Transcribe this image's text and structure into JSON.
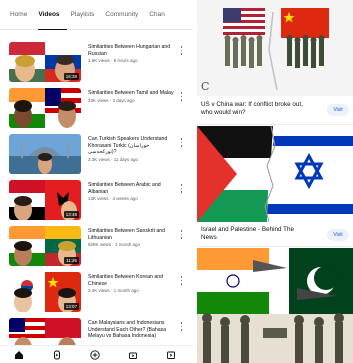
{
  "youtube": {
    "tabs": [
      "Home",
      "Videos",
      "Playlists",
      "Community",
      "Chan"
    ],
    "active_tab": "Videos",
    "videos": [
      {
        "title": "Similarities Between Hungarian and Russian",
        "meta": "1.6K views · 8 hours ago",
        "duration": "16:38"
      },
      {
        "title": "Similarities Between Tamil and Malay",
        "meta": "33K views · 3 days ago",
        "duration": ""
      },
      {
        "title": "Can Turkish Speakers Understand Khorasani Turkic (خوراسان تورکجه‌سی)?",
        "meta": "3.3K views · 11 days ago",
        "duration": ""
      },
      {
        "title": "Similarities Between Arabic and Albanian",
        "meta": "13K views · 3 weeks ago",
        "duration": "13:48"
      },
      {
        "title": "Similarities Between Sanskrit and Lithuanian",
        "meta": "928K views · 1 month ago",
        "duration": "11:26"
      },
      {
        "title": "Similarities Between Korean and Chinese",
        "meta": "3.4K views · 1 month ago",
        "duration": "13:07"
      },
      {
        "title": "Can Malaysians and Indonesians Understand Each Other? (Bahasa Melayu vs Bahasa Indonesia)",
        "meta": "",
        "duration": ""
      }
    ]
  },
  "feed": {
    "visit_label": "Visit",
    "articles": [
      {
        "title": "US v China war: If conflict broke out, who would win?",
        "badge": "C"
      },
      {
        "title": "Israel and Palestine - Behind The News"
      }
    ]
  },
  "colors": {
    "yt_text": "#0f0f0f",
    "yt_meta": "#606060",
    "visit_text": "#1a5fd6",
    "visit_bg": "#eef2f8"
  }
}
